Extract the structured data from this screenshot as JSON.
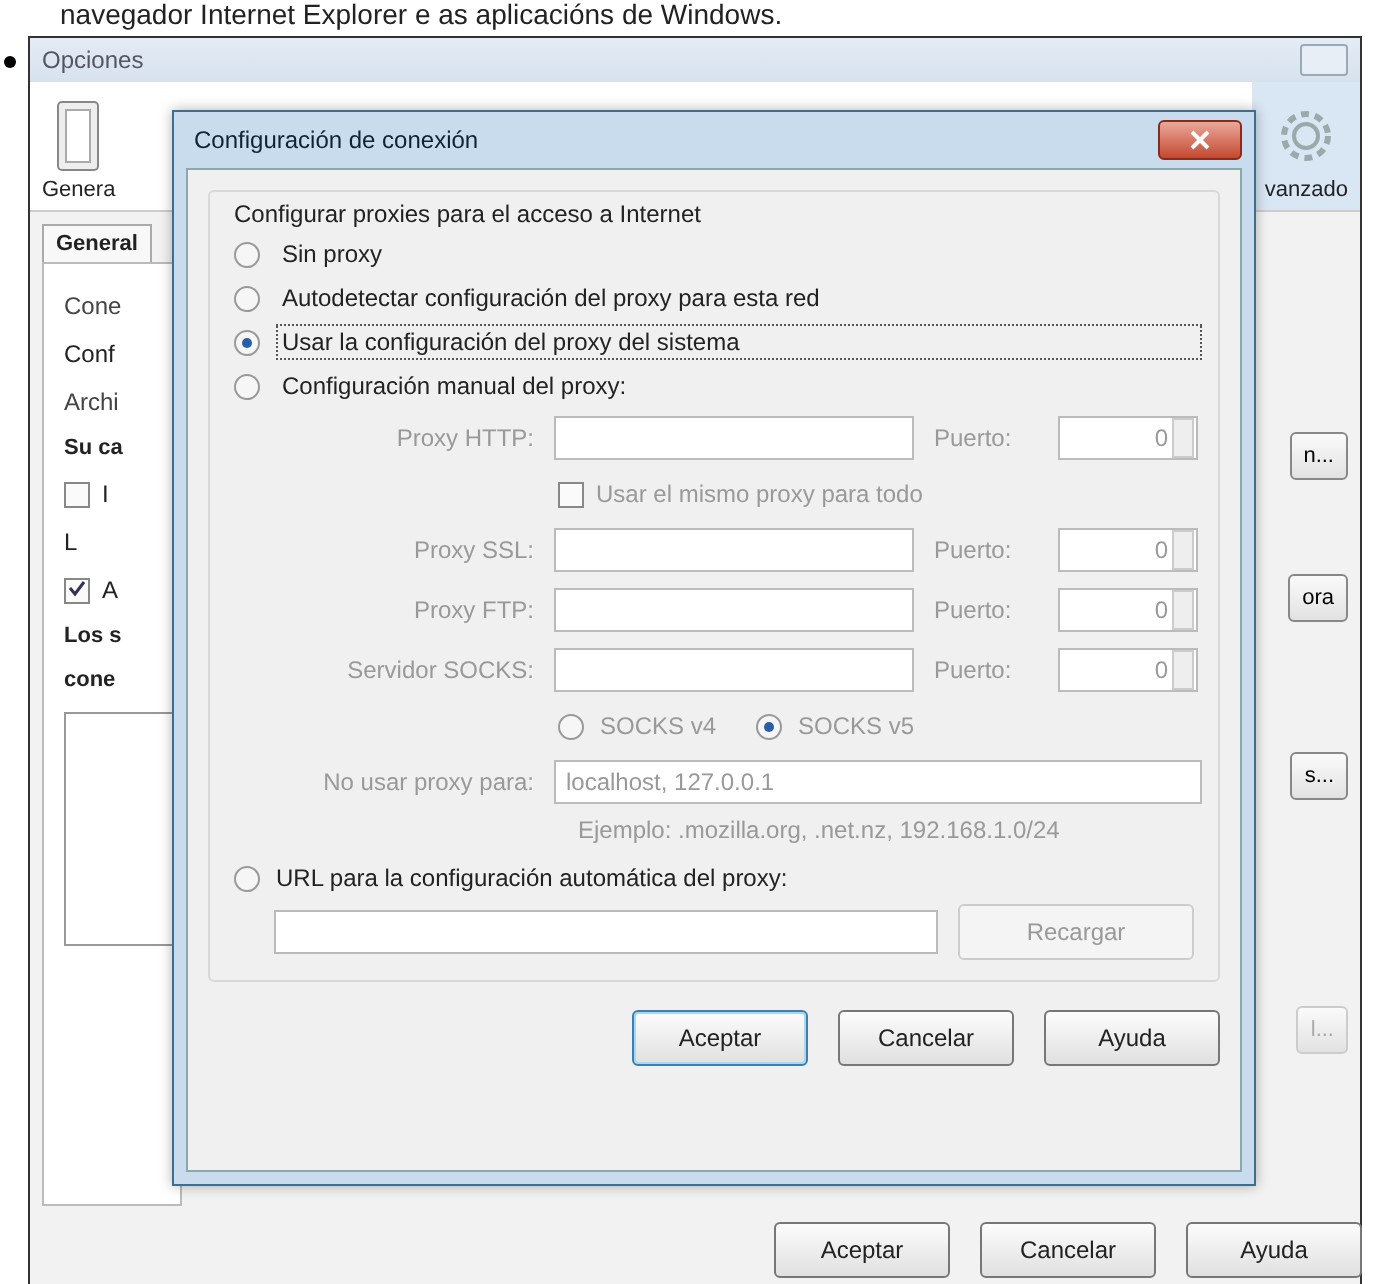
{
  "caption": "navegador Internet Explorer e as aplicacións de Windows.",
  "options_window": {
    "title": "Opciones",
    "toolbar": [
      {
        "kind": "switch",
        "label": "Genera",
        "selected": false
      },
      {
        "kind": "gear",
        "label": "vanzado",
        "selected": true
      }
    ],
    "tabs": [
      {
        "label": "General",
        "selected": true
      }
    ],
    "fragments": [
      {
        "kind": "legend",
        "text": "Cone"
      },
      {
        "kind": "text",
        "text": "Conf"
      },
      {
        "kind": "legend",
        "text": "Archi"
      },
      {
        "kind": "bold",
        "text": "Su ca"
      },
      {
        "kind": "checkbox",
        "text": "I",
        "checked": false
      },
      {
        "kind": "text",
        "text": "L"
      },
      {
        "kind": "checkbox",
        "text": "A",
        "checked": true
      },
      {
        "kind": "bold",
        "text": "Los s"
      },
      {
        "kind": "bold",
        "text": "cone"
      },
      {
        "kind": "listbox"
      }
    ],
    "side_buttons": [
      {
        "label": "n...",
        "disabled": false
      },
      {
        "label": "ora",
        "disabled": false
      },
      {
        "label": "s...",
        "disabled": false
      },
      {
        "label": "l...",
        "disabled": true
      }
    ],
    "buttons": [
      {
        "label": "Aceptar"
      },
      {
        "label": "Cancelar"
      },
      {
        "label": "Ayuda"
      }
    ]
  },
  "dialog": {
    "title": "Configuración de conexión",
    "group_label": "Configurar proxies para el acceso a Internet",
    "modes": [
      {
        "label": "Sin proxy",
        "selected": false,
        "focused": false
      },
      {
        "label": "Autodetectar configuración del proxy para esta red",
        "selected": false,
        "focused": false
      },
      {
        "label": "Usar la configuración del proxy del sistema",
        "selected": true,
        "focused": true
      },
      {
        "label": "Configuración manual del proxy:",
        "selected": false,
        "focused": false
      }
    ],
    "manual": {
      "disabled": true,
      "http": {
        "label": "Proxy HTTP:",
        "port_label": "Puerto:",
        "port": "0"
      },
      "same_proxy": {
        "label": "Usar el mismo proxy para todo",
        "checked": false
      },
      "others": [
        {
          "label": "Proxy SSL:",
          "port_label": "Puerto:",
          "port": "0"
        },
        {
          "label": "Proxy FTP:",
          "port_label": "Puerto:",
          "port": "0"
        },
        {
          "label": "Servidor SOCKS:",
          "port_label": "Puerto:",
          "port": "0"
        }
      ],
      "socks_versions": [
        {
          "label": "SOCKS v4",
          "selected": false
        },
        {
          "label": "SOCKS v5",
          "selected": true
        }
      ],
      "no_proxy": {
        "label": "No usar proxy para:",
        "value": "localhost, 127.0.0.1"
      },
      "example": "Ejemplo: .mozilla.org, .net.nz, 192.168.1.0/24"
    },
    "auto_url": {
      "label": "URL para la configuración automática del proxy:",
      "selected": false,
      "reload": {
        "label": "Recargar",
        "disabled": true
      }
    },
    "buttons": [
      {
        "label": "Aceptar",
        "default": true
      },
      {
        "label": "Cancelar",
        "default": false
      },
      {
        "label": "Ayuda",
        "default": false
      }
    ]
  }
}
